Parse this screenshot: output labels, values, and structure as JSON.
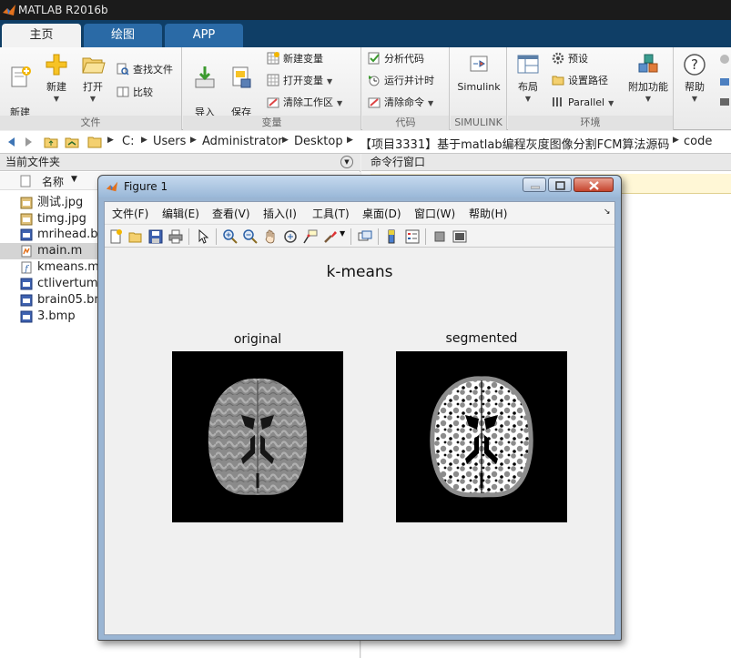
{
  "app": {
    "title": "MATLAB R2016b"
  },
  "tabs": [
    {
      "label": "主页"
    },
    {
      "label": "绘图"
    },
    {
      "label": "APP"
    }
  ],
  "ribbon": {
    "file": {
      "section_label": "文件",
      "new_script": "新建\n脚本",
      "new": "新建",
      "open": "打开",
      "find_files": "查找文件",
      "compare": "比较"
    },
    "variable": {
      "section_label": "变量",
      "import": "导入\n数据",
      "save_workspace": "保存\n工作区",
      "new_variable": "新建变量",
      "open_variable": "打开变量",
      "clear_workspace": "清除工作区"
    },
    "code": {
      "section_label": "代码",
      "analyze": "分析代码",
      "run_time": "运行并计时",
      "clear_commands": "清除命令"
    },
    "simulink": {
      "section_label": "SIMULINK",
      "simulink": "Simulink"
    },
    "environment": {
      "section_label": "环境",
      "layout": "布局",
      "preferences": "预设",
      "set_path": "设置路径",
      "parallel": "Parallel",
      "addons": "附加功能"
    },
    "help": {
      "help": "帮助"
    }
  },
  "address": {
    "crumbs": [
      "C:",
      "Users",
      "Administrator",
      "Desktop",
      "【项目3331】基于matlab编程灰度图像分割FCM算法源码程序",
      "code"
    ]
  },
  "current_folder": {
    "title": "当前文件夹",
    "column_name": "名称",
    "files": [
      {
        "name": "测试.jpg",
        "type": "jpg"
      },
      {
        "name": "timg.jpg",
        "type": "jpg"
      },
      {
        "name": "mrihead.bmp",
        "type": "bmp"
      },
      {
        "name": "main.m",
        "type": "m",
        "selected": true
      },
      {
        "name": "kmeans.m",
        "type": "m"
      },
      {
        "name": "ctlivertumor.bmp",
        "type": "bmp"
      },
      {
        "name": "brain05.bmp",
        "type": "bmp"
      },
      {
        "name": "3.bmp",
        "type": "bmp"
      }
    ]
  },
  "command_window": {
    "title": "命令行窗口"
  },
  "figure": {
    "window_title": "Figure 1",
    "menu": [
      "文件(F)",
      "编辑(E)",
      "查看(V)",
      "插入(I)",
      "工具(T)",
      "桌面(D)",
      "窗口(W)",
      "帮助(H)"
    ],
    "suptitle": "k-means",
    "axes": [
      {
        "title": "original"
      },
      {
        "title": "segmented"
      }
    ]
  },
  "colors": {
    "tab_strip": "#0f3e66",
    "tab_active": "#f2f2f2",
    "figure_frame": "#9ab5d3",
    "axes_background": "#000000"
  }
}
